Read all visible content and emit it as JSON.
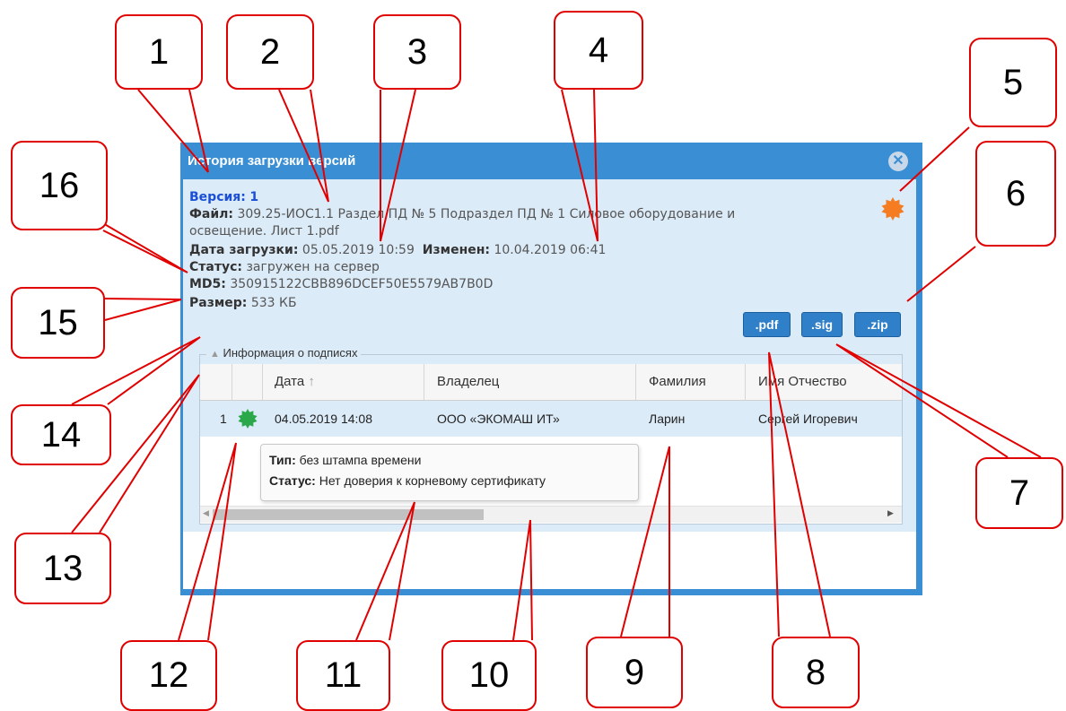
{
  "dialog": {
    "title": "История загрузки версий",
    "close_icon": "close-circle-icon",
    "version_label": "Версия:",
    "version_value": "1",
    "file_label": "Файл:",
    "file_value_line1": "309.25-ИОС1.1 Раздел ПД № 5 Подраздел ПД № 1 Силовое оборудование и",
    "file_value_line2": "освещение. Лист 1.pdf",
    "upload_date_label": "Дата загрузки:",
    "upload_date_value": "05.05.2019 10:59",
    "modified_label": "Изменен:",
    "modified_value": "10.04.2019 06:41",
    "status_label": "Статус:",
    "status_value": "загружен на сервер",
    "md5_label": "MD5:",
    "md5_value": "350915122CBB896DCEF50E5579AB7B0D",
    "size_label": "Размер:",
    "size_value": "533 КБ",
    "seal_icon": "orange-seal-icon",
    "seal_color": "#f57c20",
    "buttons": {
      "pdf": ".pdf",
      "sig": ".sig",
      "zip": ".zip"
    },
    "button_color": "#2f7fc9",
    "accent_color": "#3a8fd4"
  },
  "signatures": {
    "legend": "Информация о подписях",
    "collapse_icon": "triangle-up-icon",
    "columns": {
      "date": "Дата",
      "owner": "Владелец",
      "surname": "Фамилия",
      "name": "Имя Отчество"
    },
    "sort_icon": "sort-up-arrow-icon",
    "rows": [
      {
        "num": "1",
        "status_icon": "green-seal-icon",
        "date": "04.05.2019 14:08",
        "owner": "ООО «ЭКОМАШ ИТ»",
        "surname": "Ларин",
        "name": "Сергей Игоревич"
      }
    ],
    "tooltip": {
      "type_label": "Тип:",
      "type_value": "без штампа времени",
      "status_label": "Статус:",
      "status_value": "Нет доверия к корневому сертификату"
    },
    "status_color": "#2aa84a"
  },
  "callouts": [
    "1",
    "2",
    "3",
    "4",
    "5",
    "6",
    "7",
    "8",
    "9",
    "10",
    "11",
    "12",
    "13",
    "14",
    "15",
    "16"
  ],
  "callout_color": "#e00000"
}
